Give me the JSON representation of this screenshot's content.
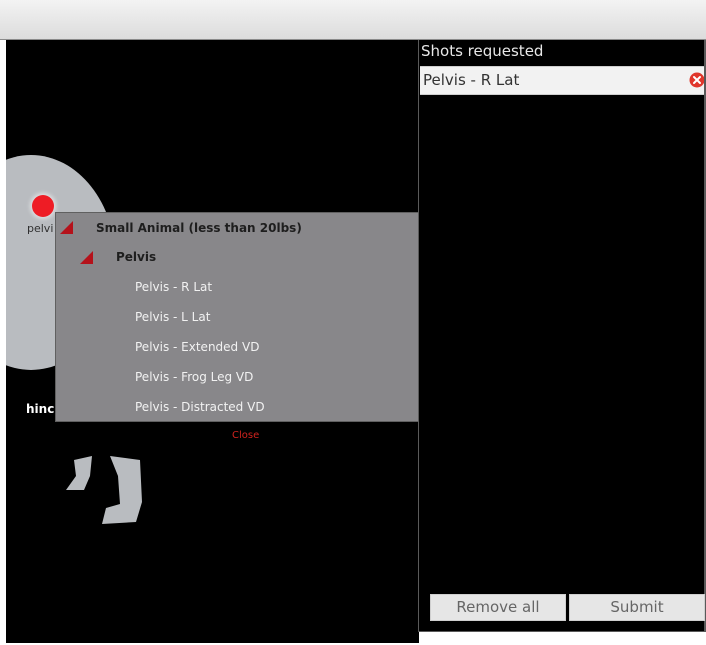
{
  "canvas": {
    "marker_label": "pelvi",
    "hind_label": "hinc"
  },
  "dropdown": {
    "category": "Small Animal (less than 20lbs)",
    "subcategory": "Pelvis",
    "items": [
      "Pelvis - R Lat",
      "Pelvis - L Lat",
      "Pelvis - Extended VD",
      "Pelvis - Frog Leg VD",
      "Pelvis - Distracted VD"
    ],
    "close_label": "Close"
  },
  "panel": {
    "title": "Shots requested",
    "shots": [
      "Pelvis - R Lat"
    ],
    "remove_all_label": "Remove all",
    "submit_label": "Submit"
  },
  "colors": {
    "accent_red": "#b5121b",
    "marker_red": "#ee1c25",
    "dropdown_bg": "#88878a",
    "close_link": "#d2231e"
  },
  "icons": {
    "remove": "remove-circle-x-icon",
    "expand": "expanded-triangle-icon"
  }
}
